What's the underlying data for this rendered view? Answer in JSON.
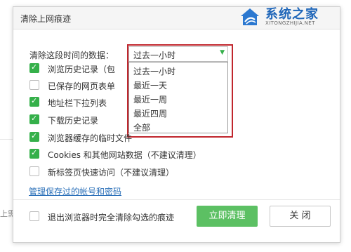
{
  "dialog": {
    "title": "清除上网痕迹",
    "period_label": "清除这段时间的数据：",
    "period_select": {
      "value": "过去一小时",
      "options": [
        "过去一小时",
        "最近一天",
        "最近一周",
        "最近四周",
        "全部"
      ]
    },
    "options": [
      {
        "label": "浏览历史记录（包",
        "checked": true
      },
      {
        "label": "已保存的网页表单",
        "checked": false
      },
      {
        "label": "地址栏下拉列表",
        "checked": true
      },
      {
        "label": "下载历史记录",
        "checked": true
      },
      {
        "label": "浏览器缓存的临时文件",
        "checked": true
      },
      {
        "label": "Cookies 和其他网站数据（不建议清理）",
        "checked": true
      },
      {
        "label": "新标签页快速访问（不建议清理）",
        "checked": false
      }
    ],
    "manage_link": "管理保存过的帐号和密码",
    "exit_option": {
      "label": "退出浏览器时完全清除勾选的痕迹",
      "checked": false
    },
    "clear_button": "立即清理",
    "close_button": "关 闭"
  },
  "background": {
    "partial_text": "上需"
  },
  "watermark": {
    "main": "系统之家",
    "sub": "XITONGZHIJIA.NET"
  },
  "colors": {
    "accent_green": "#35b04a",
    "button_green": "#5cc063",
    "highlight_red": "#c0262d",
    "link_blue": "#2a6fb8",
    "watermark_blue": "#1f66b9"
  }
}
